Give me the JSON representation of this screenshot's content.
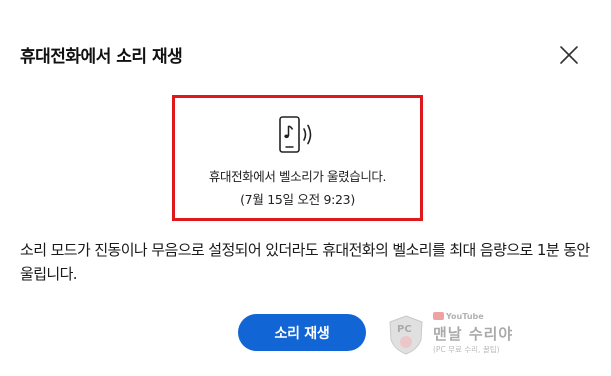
{
  "dialog": {
    "title": "휴대전화에서 소리 재생",
    "close_icon": "close-icon"
  },
  "notice": {
    "icon": "phone-ringing-icon",
    "message": "휴대전화에서 벨소리가 울렸습니다.",
    "timestamp": "(7월 15일 오전 9:23)",
    "highlight_color": "#e0181b"
  },
  "description": "소리 모드가 진동이나 무음으로 설정되어 있더라도 휴대전화의 벨소리를 최대 음량으로 1분 동안 울립니다.",
  "actions": {
    "play_sound_label": "소리 재생",
    "button_color": "#1165d4"
  },
  "watermark": {
    "logo_text": "PC",
    "youtube_label": "YouTube",
    "channel_name": "맨날 수리야",
    "subtitle": "(PC 무료 수리, 꿀팁)"
  }
}
